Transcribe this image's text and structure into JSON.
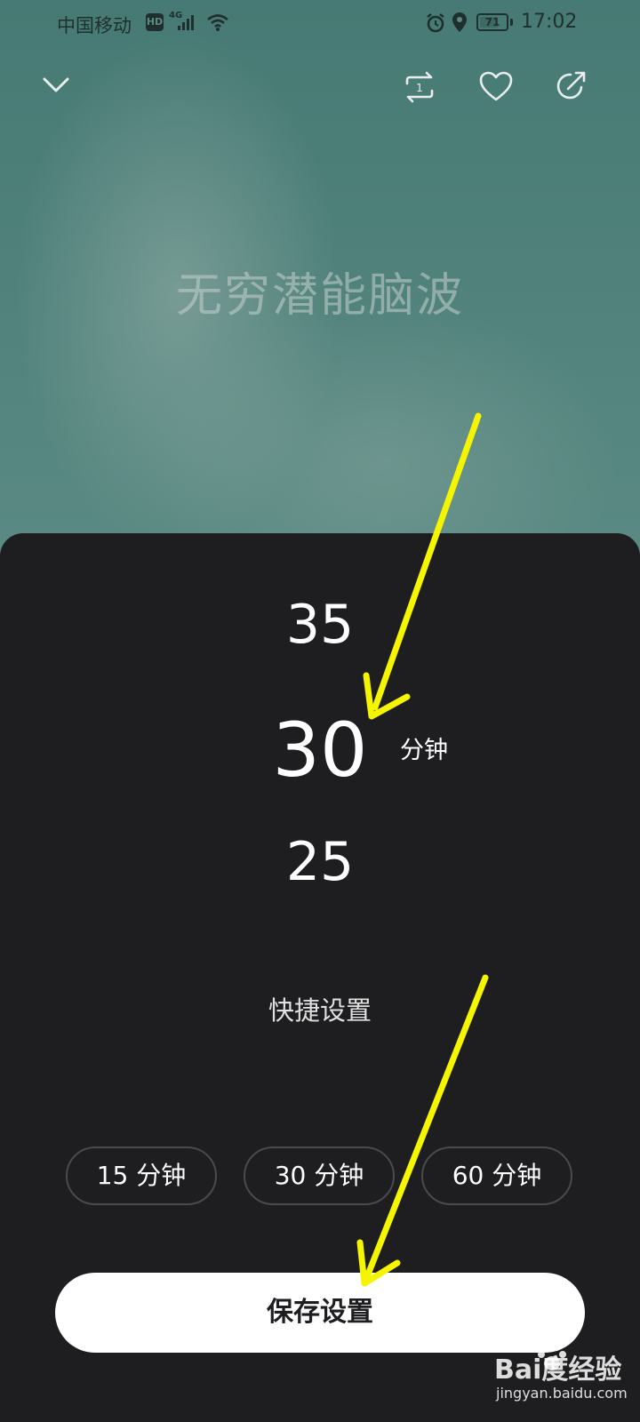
{
  "status_bar": {
    "carrier": "中国移动",
    "hd": "HD",
    "network": "4G",
    "battery": "71",
    "battery_level": 0.71,
    "time": "17:02"
  },
  "player": {
    "title": "无穷潜能脑波",
    "icons": {
      "collapse": "chevron-down-icon",
      "repeat": "repeat-one-icon",
      "favorite": "heart-icon",
      "share": "share-icon"
    }
  },
  "timer_sheet": {
    "picker": {
      "prev": "35",
      "current": "30",
      "next": "25",
      "unit": "分钟"
    },
    "quick_title": "快捷设置",
    "quick_options": [
      "15 分钟",
      "30 分钟",
      "60 分钟"
    ],
    "save_label": "保存设置"
  },
  "watermark": {
    "brand": "Bai度经验",
    "url": "jingyan.baidu.com"
  },
  "colors": {
    "sheet_bg": "#1e1e20",
    "annotation_arrow": "#f5f500",
    "save_button_bg": "#ffffff"
  }
}
